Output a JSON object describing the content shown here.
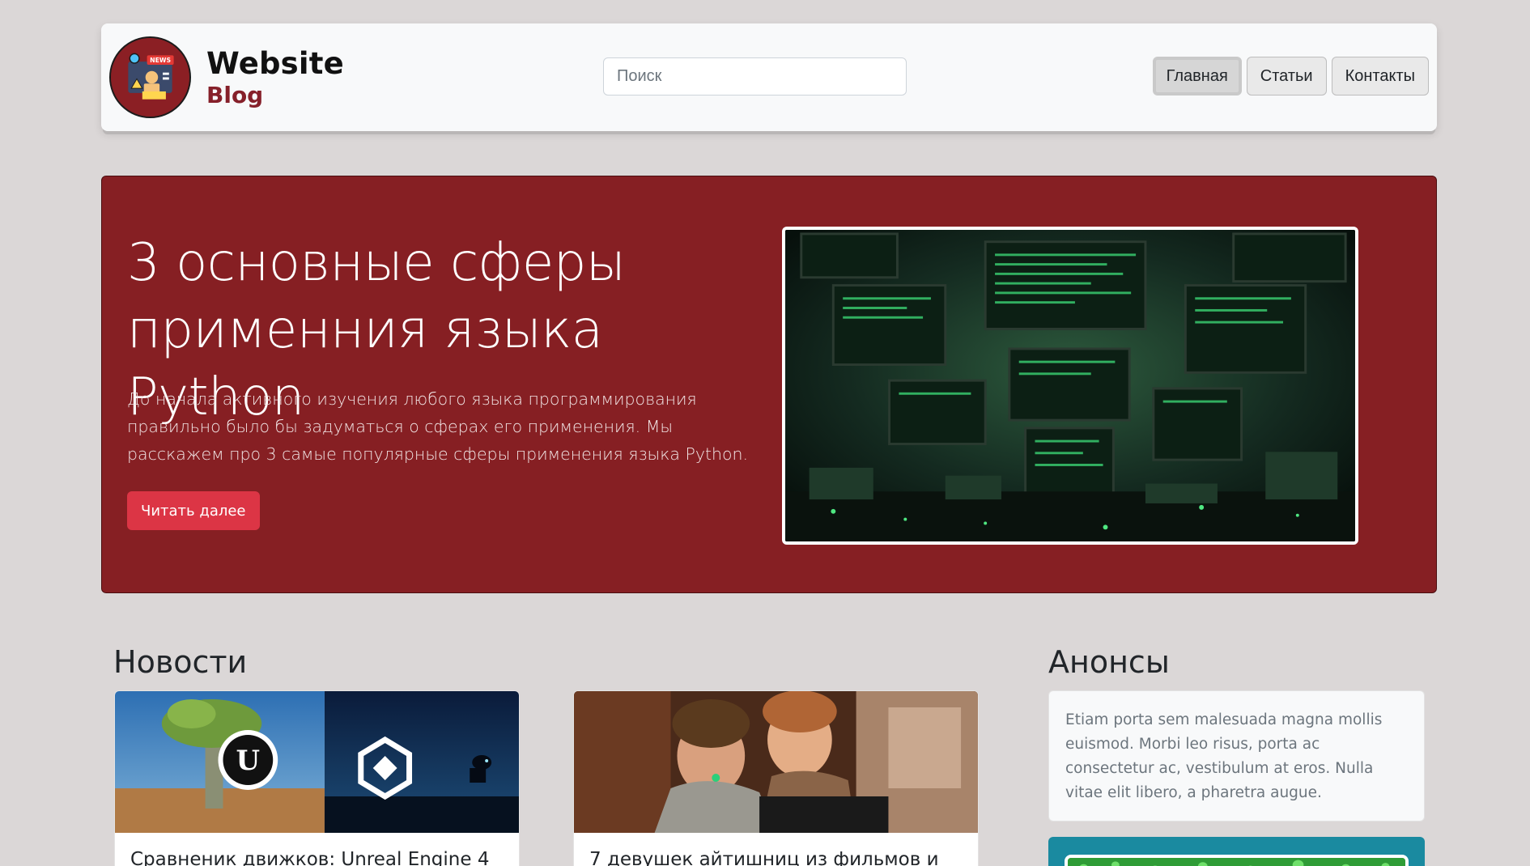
{
  "header": {
    "brand_line1": "Website",
    "brand_line2": "Blog",
    "logo_text": "NEWS",
    "search_placeholder": "Поиск",
    "nav": [
      {
        "label": "Главная",
        "active": true
      },
      {
        "label": "Статьи",
        "active": false
      },
      {
        "label": "Контакты",
        "active": false
      }
    ]
  },
  "hero": {
    "title": "3 основные сферы применния языка Python",
    "text": "До начала активного изучения любого языка программирования правильно было бы задуматься о сферах его применения. Мы расскажем про 3 самые популярные сферы применения языка Python.",
    "button_label": "Читать далее",
    "image_icon": "computer-monitors-image"
  },
  "news": {
    "title": "Новости",
    "cards": [
      {
        "title": "Сравненик движков: Unreal Engine 4",
        "image_icon": "unreal-vs-unity-image"
      },
      {
        "title": "7 девушек айтишниц из фильмов и",
        "image_icon": "two-men-laptop-image"
      }
    ]
  },
  "announcements": {
    "title": "Анонсы",
    "text": "Etiam porta sem malesuada magna mollis euismod. Morbi leo risus, porta ac consectetur ac, vestibulum at eros. Nulla vitae elit libero, a pharetra augue."
  },
  "colors": {
    "page_bg": "#dbd7d7",
    "hero_bg": "#861f23",
    "brand_accent": "#86202a",
    "button_danger": "#dc3545",
    "announcement_accent": "#1a8aa0"
  }
}
